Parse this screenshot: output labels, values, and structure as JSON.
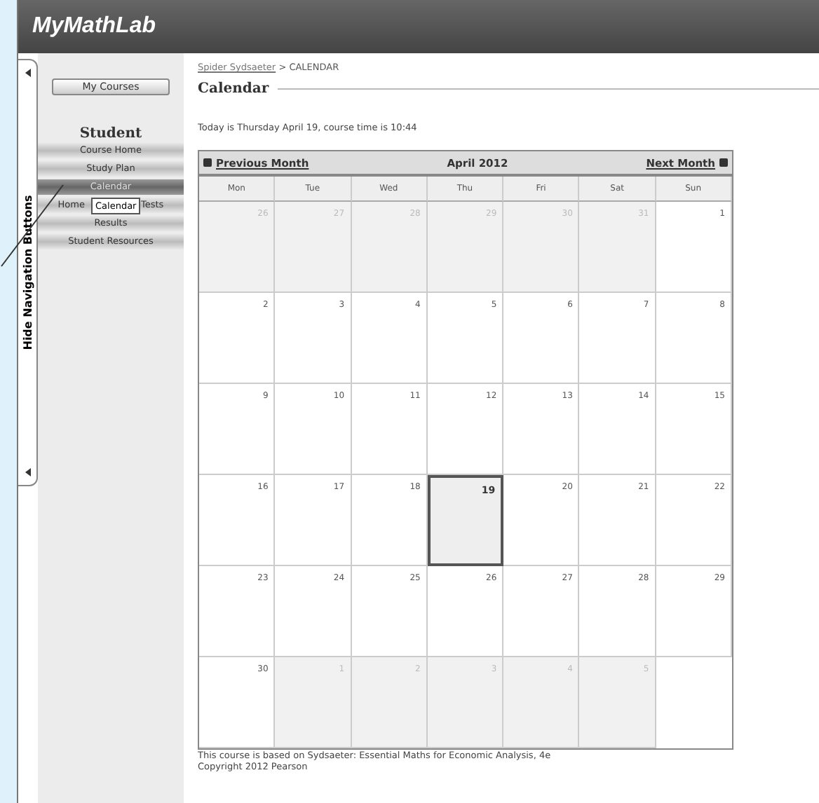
{
  "header": {
    "logo": "MyMathLab"
  },
  "side_tab": {
    "label": "Hide Navigation Buttons"
  },
  "sidebar": {
    "my_courses": "My Courses",
    "heading": "Student",
    "items": [
      {
        "label": "Course Home",
        "selected": false
      },
      {
        "label": "Study Plan",
        "selected": false
      },
      {
        "label": "Calendar",
        "selected": true
      },
      {
        "label": "Home",
        "label_end": "Tests",
        "selected": false
      },
      {
        "label": "Results",
        "selected": false
      },
      {
        "label": "Student Resources",
        "selected": false
      }
    ]
  },
  "callout": {
    "label": "Calendar"
  },
  "breadcrumb": {
    "link": "Spider Sydsaeter",
    "current": "> CALENDAR"
  },
  "title": "Calendar",
  "today_text": "Today is Thursday April 19, course time is 10:44",
  "calendar": {
    "prev": "Previous Month",
    "month": "April 2012",
    "next": "Next Month",
    "weekdays": [
      "Mon",
      "Tue",
      "Wed",
      "Thu",
      "Fri",
      "Sat",
      "Sun"
    ],
    "weeks": [
      [
        {
          "day": "26",
          "other_month": true,
          "selected": false
        },
        {
          "day": "27",
          "other_month": true,
          "selected": false
        },
        {
          "day": "28",
          "other_month": true,
          "selected": false
        },
        {
          "day": "29",
          "other_month": true,
          "selected": false
        },
        {
          "day": "30",
          "other_month": true,
          "selected": false
        },
        {
          "day": "31",
          "other_month": true,
          "selected": false
        },
        {
          "day": "1",
          "other_month": false,
          "selected": false
        }
      ],
      [
        {
          "day": "2",
          "other_month": false,
          "selected": false
        },
        {
          "day": "3",
          "other_month": false,
          "selected": false
        },
        {
          "day": "4",
          "other_month": false,
          "selected": false
        },
        {
          "day": "5",
          "other_month": false,
          "selected": false
        },
        {
          "day": "6",
          "other_month": false,
          "selected": false
        },
        {
          "day": "7",
          "other_month": false,
          "selected": false
        },
        {
          "day": "8",
          "other_month": false,
          "selected": false
        }
      ],
      [
        {
          "day": "9",
          "other_month": false,
          "selected": false
        },
        {
          "day": "10",
          "other_month": false,
          "selected": false
        },
        {
          "day": "11",
          "other_month": false,
          "selected": false
        },
        {
          "day": "12",
          "other_month": false,
          "selected": false
        },
        {
          "day": "13",
          "other_month": false,
          "selected": false
        },
        {
          "day": "14",
          "other_month": false,
          "selected": false
        },
        {
          "day": "15",
          "other_month": false,
          "selected": false
        }
      ],
      [
        {
          "day": "16",
          "other_month": false,
          "selected": false
        },
        {
          "day": "17",
          "other_month": false,
          "selected": false
        },
        {
          "day": "18",
          "other_month": false,
          "selected": false
        },
        {
          "day": "19",
          "other_month": false,
          "selected": true
        },
        {
          "day": "20",
          "other_month": false,
          "selected": false
        },
        {
          "day": "21",
          "other_month": false,
          "selected": false
        },
        {
          "day": "22",
          "other_month": false,
          "selected": false
        }
      ],
      [
        {
          "day": "23",
          "other_month": false,
          "selected": false
        },
        {
          "day": "24",
          "other_month": false,
          "selected": false
        },
        {
          "day": "25",
          "other_month": false,
          "selected": false
        },
        {
          "day": "26",
          "other_month": false,
          "selected": false
        },
        {
          "day": "27",
          "other_month": false,
          "selected": false
        },
        {
          "day": "28",
          "other_month": false,
          "selected": false
        },
        {
          "day": "29",
          "other_month": false,
          "selected": false
        }
      ],
      [
        {
          "day": "30",
          "other_month": false,
          "selected": false
        },
        {
          "day": "1",
          "other_month": true,
          "selected": false
        },
        {
          "day": "2",
          "other_month": true,
          "selected": false
        },
        {
          "day": "3",
          "other_month": true,
          "selected": false
        },
        {
          "day": "4",
          "other_month": true,
          "selected": false
        },
        {
          "day": "5",
          "other_month": true,
          "selected": false
        }
      ]
    ]
  },
  "footer": [
    "This course is based on Sydsaeter: Essential Maths for Economic Analysis, 4e",
    "Copyright 2012 Pearson"
  ]
}
